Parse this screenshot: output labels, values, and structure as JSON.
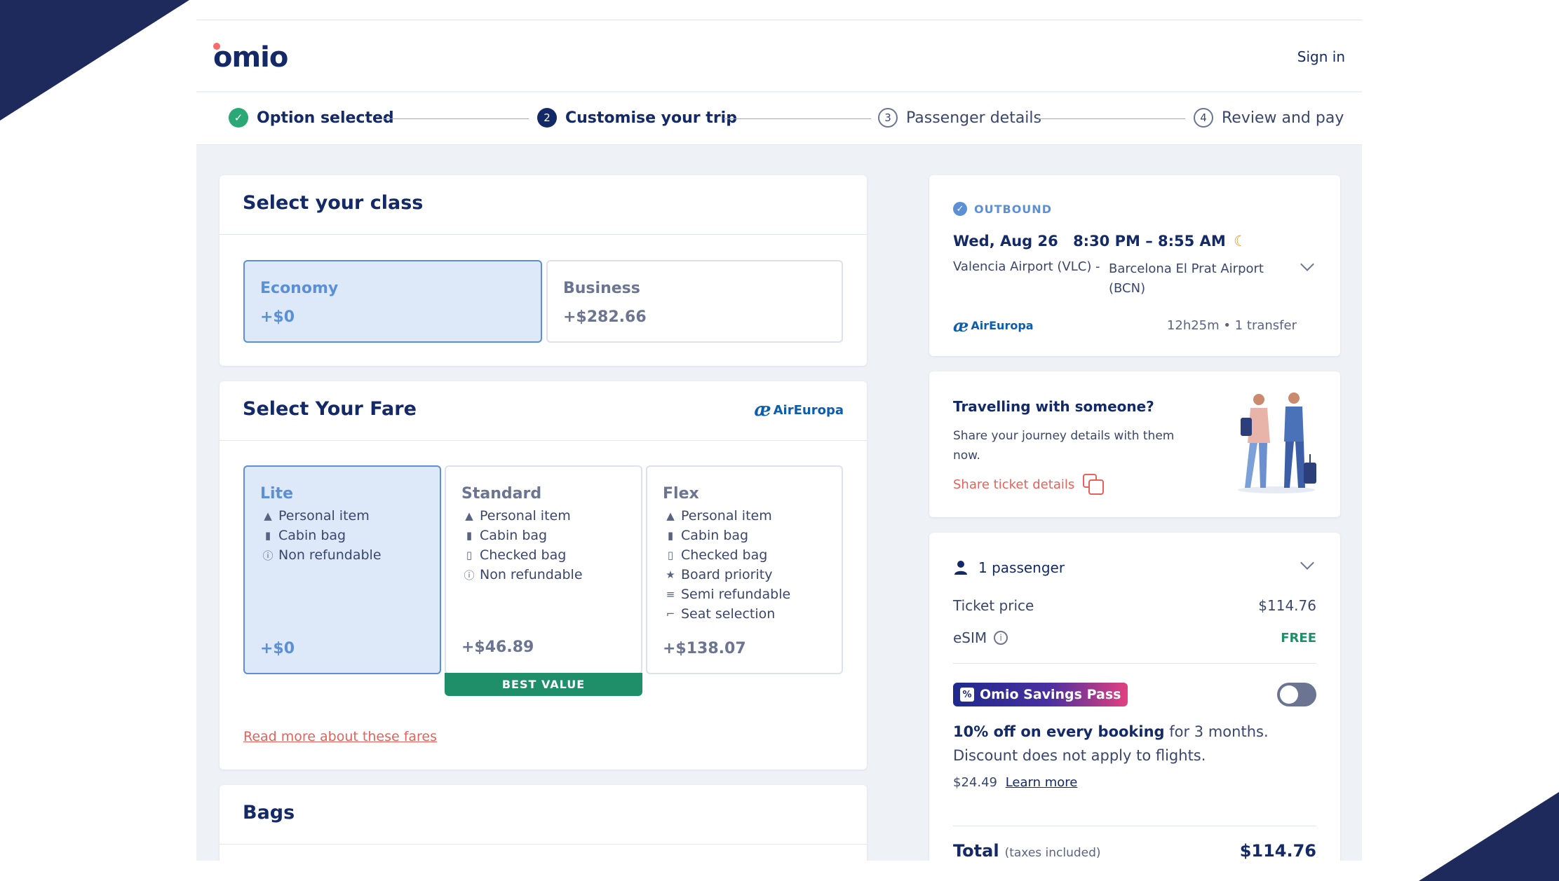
{
  "brand": {
    "logo": "omio",
    "accent": "#fa6b6b",
    "navy": "#132968"
  },
  "header": {
    "signin": "Sign in"
  },
  "steps": [
    {
      "num": "",
      "label": "Option selected",
      "state": "done"
    },
    {
      "num": "2",
      "label": "Customise your trip",
      "state": "active"
    },
    {
      "num": "3",
      "label": "Passenger details",
      "state": "todo"
    },
    {
      "num": "4",
      "label": "Review and pay",
      "state": "todo"
    }
  ],
  "class_section": {
    "title": "Select your class",
    "options": [
      {
        "name": "Economy",
        "price": "+$0",
        "selected": true
      },
      {
        "name": "Business",
        "price": "+$282.66",
        "selected": false
      }
    ]
  },
  "fare_section": {
    "title": "Select Your Fare",
    "airline": "AirEuropa",
    "fares": [
      {
        "name": "Lite",
        "price": "+$0",
        "selected": true,
        "features": [
          {
            "icon": "personal-item-icon",
            "label": "Personal item"
          },
          {
            "icon": "cabin-bag-icon",
            "label": "Cabin bag"
          },
          {
            "icon": "info-icon",
            "label": "Non refundable"
          }
        ]
      },
      {
        "name": "Standard",
        "price": "+$46.89",
        "selected": false,
        "badge": "BEST VALUE",
        "features": [
          {
            "icon": "personal-item-icon",
            "label": "Personal item"
          },
          {
            "icon": "cabin-bag-icon",
            "label": "Cabin bag"
          },
          {
            "icon": "checked-bag-icon",
            "label": "Checked bag"
          },
          {
            "icon": "info-icon",
            "label": "Non refundable"
          }
        ]
      },
      {
        "name": "Flex",
        "price": "+$138.07",
        "selected": false,
        "features": [
          {
            "icon": "personal-item-icon",
            "label": "Personal item"
          },
          {
            "icon": "cabin-bag-icon",
            "label": "Cabin bag"
          },
          {
            "icon": "checked-bag-icon",
            "label": "Checked bag"
          },
          {
            "icon": "star-icon",
            "label": "Board priority"
          },
          {
            "icon": "semi-refund-icon",
            "label": "Semi refundable"
          },
          {
            "icon": "seat-icon",
            "label": "Seat selection"
          }
        ]
      }
    ],
    "read_more": "Read more about these fares"
  },
  "bags_section": {
    "title": "Bags"
  },
  "outbound": {
    "label": "OUTBOUND",
    "date": "Wed, Aug 26",
    "time": "8:30 PM – 8:55 AM",
    "from": "Valencia Airport (VLC)",
    "separator": "-",
    "to_line1": "Barcelona El Prat Airport",
    "to_line2": "(BCN)",
    "airline": "AirEuropa",
    "duration": "12h25m • 1 transfer"
  },
  "share": {
    "title": "Travelling with someone?",
    "text_line1": "Share your journey details with them",
    "text_line2": "now.",
    "link": "Share ticket details"
  },
  "summary": {
    "passengers": "1 passenger",
    "ticket_label": "Ticket price",
    "ticket_value": "$114.76",
    "esim_label": "eSIM",
    "esim_value": "FREE",
    "pass_badge": "Omio Savings Pass",
    "pass_bold": "10% off on every booking",
    "pass_rest": " for 3 months.",
    "pass_note": "Discount does not apply to flights.",
    "pass_price": "$24.49",
    "pass_learn": "Learn more",
    "total_label": "Total",
    "total_note": "(taxes included)",
    "total_value": "$114.76"
  }
}
